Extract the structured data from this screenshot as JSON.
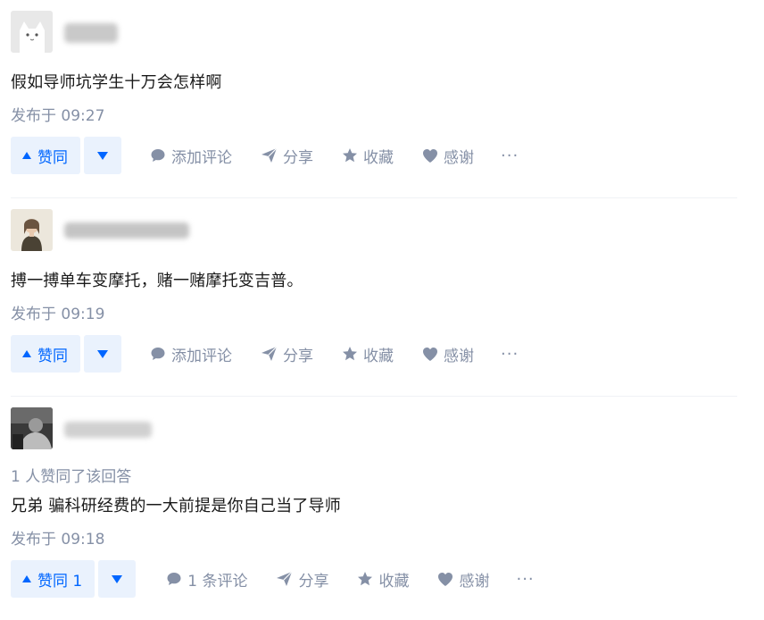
{
  "answers": [
    {
      "avatar_icon": "avatar-cat-icon",
      "voted_by": "",
      "content": "假如导师坑学生十万会怎样啊",
      "time": "发布于 09:27",
      "upvote_label": "赞同",
      "comment_label": "添加评论",
      "share_label": "分享",
      "collect_label": "收藏",
      "thanks_label": "感谢",
      "more_label": "···"
    },
    {
      "avatar_icon": "avatar-person-icon",
      "voted_by": "",
      "content": "搏一搏单车变摩托，赌一赌摩托变吉普。",
      "time": "发布于 09:19",
      "upvote_label": "赞同",
      "comment_label": "添加评论",
      "share_label": "分享",
      "collect_label": "收藏",
      "thanks_label": "感谢",
      "more_label": "···"
    },
    {
      "avatar_icon": "avatar-bw-photo-icon",
      "voted_by": "1 人赞同了该回答",
      "content": "兄弟 骗科研经费的一大前提是你自己当了导师",
      "time": "发布于 09:18",
      "upvote_label": "赞同 1",
      "comment_label": "1 条评论",
      "share_label": "分享",
      "collect_label": "收藏",
      "thanks_label": "感谢",
      "more_label": "···"
    }
  ],
  "colors": {
    "accent": "#0066ff",
    "accent_bg": "#eaf2fd",
    "meta": "#8590a6"
  }
}
